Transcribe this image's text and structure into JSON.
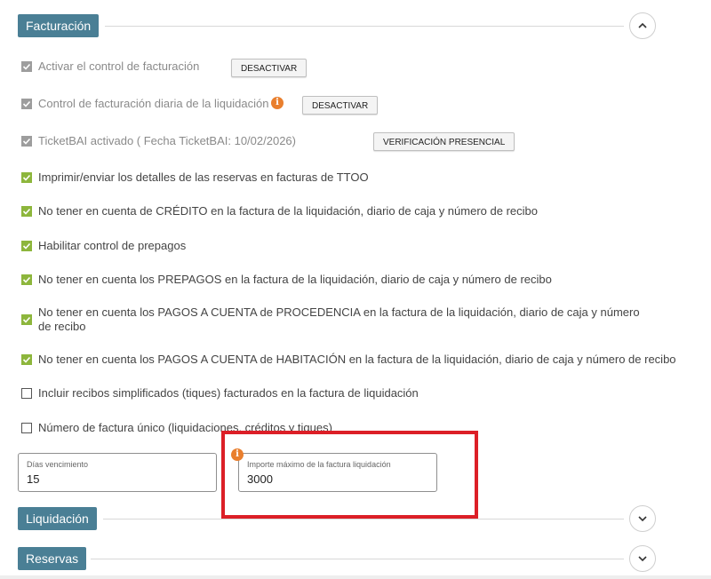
{
  "sections": {
    "facturacion": "Facturación",
    "liquidacion": "Liquidación",
    "reservas": "Reservas"
  },
  "options": {
    "activar_control": "Activar el control de facturación",
    "control_diaria": "Control de facturación diaria de la liquidación",
    "ticketbai": "TicketBAI activado ( Fecha TicketBAI: 10/02/2026)",
    "imprimir_ttoo": "Imprimir/enviar los detalles de las reservas en facturas de TTOO",
    "no_credito": "No tener en cuenta de CRÉDITO en la factura de la liquidación, diario de caja y número de recibo",
    "habilitar_prepagos": "Habilitar control de prepagos",
    "no_prepagos": "No tener en cuenta los PREPAGOS en la factura de la liquidación, diario de caja y número de recibo",
    "no_pagos_procedencia": "No tener en cuenta los PAGOS A CUENTA de PROCEDENCIA en la factura de la liquidación, diario de caja y número de recibo",
    "no_pagos_habitacion": "No tener en cuenta los PAGOS A CUENTA de HABITACIÓN en la factura de la liquidación, diario de caja y número de recibo",
    "incluir_recibos": "Incluir recibos simplificados (tiques) facturados en la factura de liquidación",
    "numero_unico": "Número de factura único (liquidaciones, créditos y tiques)"
  },
  "buttons": {
    "desactivar_1": "DESACTIVAR",
    "desactivar_2": "DESACTIVAR",
    "verificacion": "VERIFICACIÓN PRESENCIAL"
  },
  "fields": {
    "dias_label": "Días vencimiento",
    "dias_value": "15",
    "importe_label": "Importe máximo de la factura liquidación",
    "importe_value": "3000"
  },
  "icons": {
    "info": "i"
  },
  "colors": {
    "section_tag": "#4a7f95",
    "checkbox_checked": "#8db63c",
    "checkbox_disabled": "#9d9d9d",
    "info": "#e97f2e",
    "highlight": "#dc1f27"
  }
}
